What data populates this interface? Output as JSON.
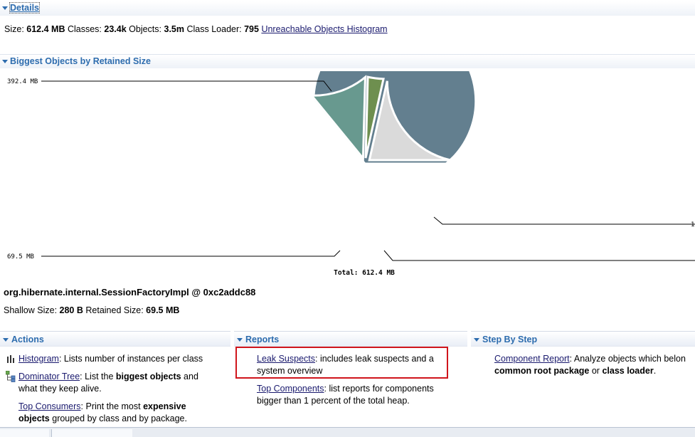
{
  "details": {
    "title": "Details",
    "size_label": "Size:",
    "size_value": "612.4 MB",
    "classes_label": "Classes:",
    "classes_value": "23.4k",
    "objects_label": "Objects:",
    "objects_value": "3.5m",
    "loader_label": "Class Loader:",
    "loader_value": "795",
    "unreachable_link": "Unreachable Objects Histogram"
  },
  "biggest": {
    "title": "Biggest Objects by Retained Size",
    "label_top_left": "392.4 MB",
    "label_bottom_left": "69.5 MB",
    "label_right_truncated": "1",
    "total_label": "Total: 612.4 MB"
  },
  "chart_data": {
    "type": "pie",
    "total": 612.4,
    "unit": "MB",
    "values": [
      392.4,
      69.5,
      19.0,
      131.5
    ],
    "colors": [
      "#637f8f",
      "#68998f",
      "#6e8f4f",
      "#dadada"
    ],
    "labels": [
      "392.4 MB",
      "69.5 MB",
      "",
      ""
    ]
  },
  "selected": {
    "name": "org.hibernate.internal.SessionFactoryImpl @ 0xc2addc88",
    "shallow_label": "Shallow Size:",
    "shallow_value": "280 B",
    "retained_label": "Retained Size:",
    "retained_value": "69.5 MB"
  },
  "actions": {
    "title": "Actions",
    "histogram_link": "Histogram",
    "histogram_text": ": Lists number of instances per class",
    "dominator_link": "Dominator Tree",
    "dominator_text_a": ": List the ",
    "dominator_bold": "biggest objects",
    "dominator_text_b": " and",
    "dominator_text_c": "what they keep alive.",
    "consumers_link": "Top Consumers",
    "consumers_text_a": ": Print the most ",
    "consumers_bold_a": "expensive",
    "consumers_bold_b": "objects",
    "consumers_text_b": " grouped by class and by package."
  },
  "reports": {
    "title": "Reports",
    "leak_link": "Leak Suspects",
    "leak_text_a": ": includes leak suspects and a",
    "leak_text_b": "system overview",
    "top_link": "Top Components",
    "top_text_a": ": list reports for components",
    "top_text_b": "bigger than 1 percent of the total heap."
  },
  "steps": {
    "title": "Step By Step",
    "component_link": "Component Report",
    "component_text_a": ": Analyze objects which belon",
    "component_bold_a": "common root package",
    "component_text_b": " or ",
    "component_bold_b": "class loader",
    "component_text_c": "."
  },
  "colors": {
    "section_title": "#2d6cae",
    "highlight_box": "#d0151c"
  }
}
